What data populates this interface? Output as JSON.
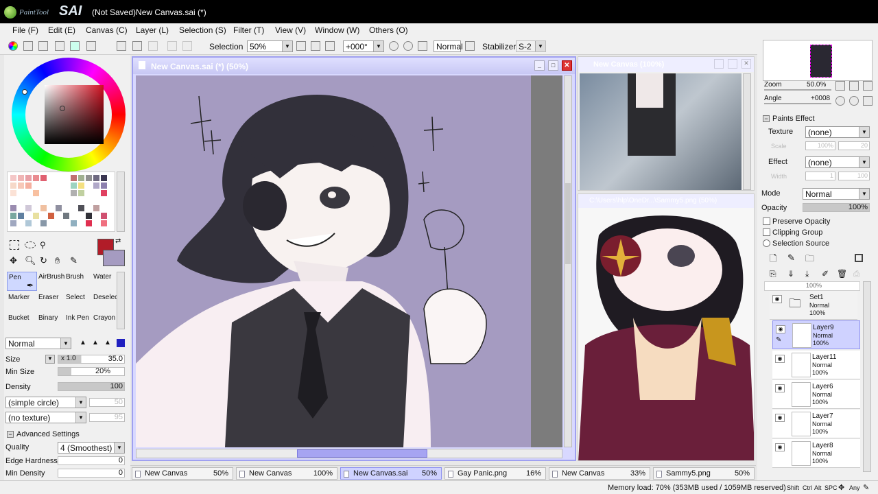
{
  "app": {
    "logo_pre": "PaintTool",
    "logo_name": "SAI",
    "title": "(Not Saved)New Canvas.sai (*)"
  },
  "menu": [
    "File (F)",
    "Edit (E)",
    "Canvas (C)",
    "Layer (L)",
    "Selection (S)",
    "Filter (T)",
    "View (V)",
    "Window (W)",
    "Others (O)"
  ],
  "toolbar": {
    "selection_label": "Selection",
    "zoom": "50%",
    "angle": "+000°",
    "blend": "Normal",
    "stabilizer_label": "Stabilizer",
    "stabilizer": "S-2"
  },
  "canvas": {
    "title": "New Canvas.sai (*) (50%)",
    "ref1_title": "New Canvas (100%)",
    "ref2_title": "C:\\Users\\hlp\\OneDr...\\Sammy5.png (50%)"
  },
  "tools": {
    "items": [
      "Pen",
      "AirBrush",
      "Brush",
      "Water",
      "Marker",
      "Eraser",
      "Select",
      "Deselect",
      "Bucket",
      "Binary",
      "Ink Pen",
      "Crayon"
    ],
    "mode": "Normal"
  },
  "params": {
    "size_label": "Size",
    "size_mult": "x 1.0",
    "size_value": "35.0",
    "minsize_label": "Min Size",
    "minsize_value": "20%",
    "density_label": "Density",
    "density_value": "100",
    "shape": "(simple circle)",
    "shape_val": "50",
    "texture": "(no texture)",
    "texture_val": "95",
    "advanced": "Advanced Settings",
    "quality_label": "Quality",
    "quality": "4 (Smoothest)",
    "edge_label": "Edge Hardness",
    "edge_value": "0",
    "mindensity_label": "Min Density",
    "mindensity_value": "0"
  },
  "navigator": {
    "zoom_label": "Zoom",
    "zoom": "50.0%",
    "angle_label": "Angle",
    "angle": "+0008"
  },
  "paints": {
    "title": "Paints Effect",
    "texture_label": "Texture",
    "texture": "(none)",
    "scale_label": "Scale",
    "scale": "100%",
    "scale2": "20",
    "effect_label": "Effect",
    "effect": "(none)",
    "width_label": "Width",
    "width": "1",
    "width2": "100"
  },
  "layerprops": {
    "mode_label": "Mode",
    "mode": "Normal",
    "opacity_label": "Opacity",
    "opacity": "100%",
    "preserve": "Preserve Opacity",
    "clipping": "Clipping Group",
    "source": "Selection Source"
  },
  "layers": [
    {
      "name": "Set1",
      "mode": "Normal",
      "opacity": "100%"
    },
    {
      "name": "Layer9",
      "mode": "Normal",
      "opacity": "100%"
    },
    {
      "name": "Layer11",
      "mode": "Normal",
      "opacity": "100%"
    },
    {
      "name": "Layer6",
      "mode": "Normal",
      "opacity": "100%"
    },
    {
      "name": "Layer7",
      "mode": "Normal",
      "opacity": "100%"
    },
    {
      "name": "Layer8",
      "mode": "Normal",
      "opacity": "100%"
    }
  ],
  "layer_top_pct": "100%",
  "tabs": [
    {
      "name": "New Canvas",
      "pct": "50%"
    },
    {
      "name": "New Canvas",
      "pct": "100%"
    },
    {
      "name": "New Canvas.sai",
      "pct": "50%"
    },
    {
      "name": "Gay Panic.png",
      "pct": "16%"
    },
    {
      "name": "New Canvas",
      "pct": "33%"
    },
    {
      "name": "Sammy5.png",
      "pct": "50%"
    }
  ],
  "status": {
    "memory": "Memory load: 70% (353MB used / 1059MB reserved)",
    "keys": [
      "Shift",
      "Ctrl",
      "Alt",
      "SPC",
      "Any"
    ]
  },
  "colors": {
    "primary": "#b11c28",
    "secondary": "#a59bc1"
  }
}
